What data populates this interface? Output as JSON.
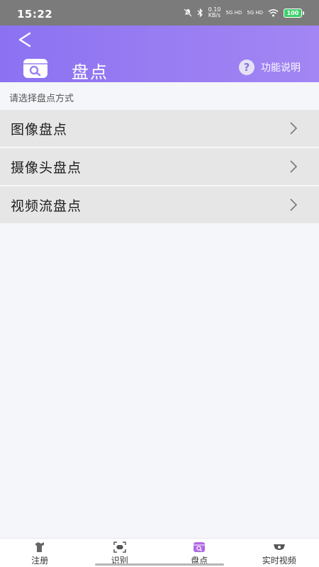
{
  "status_bar": {
    "time": "15:22",
    "net_speed_value": "0.10",
    "net_speed_unit": "KB/s",
    "signal_1": "5G HD",
    "signal_2": "5G HD",
    "battery": "100"
  },
  "header": {
    "title": "盘点",
    "help_label": "功能说明",
    "help_icon_char": "?"
  },
  "subtitle": "请选择盘点方式",
  "menu": [
    {
      "label": "图像盘点"
    },
    {
      "label": "摄像头盘点"
    },
    {
      "label": "视频流盘点"
    }
  ],
  "tabbar": [
    {
      "label": "注册",
      "icon": "register-icon"
    },
    {
      "label": "识别",
      "icon": "scan-icon"
    },
    {
      "label": "盘点",
      "icon": "inventory-icon"
    },
    {
      "label": "实时视频",
      "icon": "camera-icon"
    }
  ],
  "colors": {
    "header_start": "#8c72f2",
    "header_end": "#a386f3",
    "accent": "#b069e6",
    "menu_bg": "#e6e6e6"
  }
}
